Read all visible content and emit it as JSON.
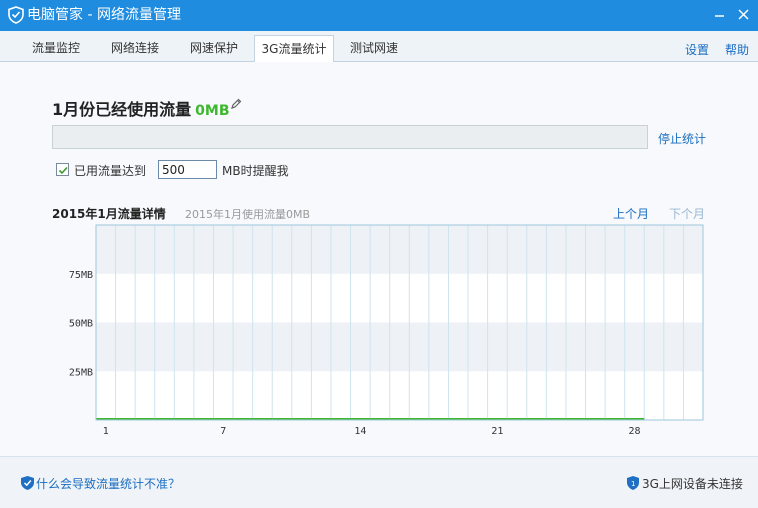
{
  "window": {
    "title": "电脑管家 - 网络流量管理",
    "accent": "#1f8ce0"
  },
  "tabs": [
    {
      "label": "流量监控",
      "active": false
    },
    {
      "label": "网络连接",
      "active": false
    },
    {
      "label": "网速保护",
      "active": false
    },
    {
      "label": "3G流量统计",
      "active": true
    },
    {
      "label": "测试网速",
      "active": false
    }
  ],
  "top_links": {
    "settings": "设置",
    "help": "帮助"
  },
  "usage": {
    "heading": "1月份已经使用流量",
    "amount": "0MB",
    "progress_fraction": 0,
    "stop_label": "停止统计"
  },
  "alert": {
    "checked": true,
    "label": "已用流量达到",
    "value": "500",
    "suffix": "MB时提醒我"
  },
  "detail": {
    "title": "2015年1月流量详情",
    "subtitle": "2015年1月使用流量0MB",
    "prev": "上个月",
    "next": "下个月"
  },
  "chart_data": {
    "type": "bar",
    "x": [
      1,
      2,
      3,
      4,
      5,
      6,
      7,
      8,
      9,
      10,
      11,
      12,
      13,
      14,
      15,
      16,
      17,
      18,
      19,
      20,
      21,
      22,
      23,
      24,
      25,
      26,
      27,
      28,
      29,
      30,
      31
    ],
    "values": [
      0,
      0,
      0,
      0,
      0,
      0,
      0,
      0,
      0,
      0,
      0,
      0,
      0,
      0,
      0,
      0,
      0,
      0,
      0,
      0,
      0,
      0,
      0,
      0,
      0,
      0,
      0,
      0,
      null,
      null,
      null
    ],
    "xticks": [
      1,
      7,
      14,
      21,
      28
    ],
    "yticks": [
      25,
      50,
      75
    ],
    "ytick_labels": [
      "25MB",
      "50MB",
      "75MB"
    ],
    "ylim": [
      0,
      100
    ],
    "xlim": [
      1,
      31
    ],
    "grid": true,
    "bar_color": "#3db82e"
  },
  "footer": {
    "help_question": "什么会导致流量统计不准？",
    "device_status": "3G上网设备未连接"
  }
}
